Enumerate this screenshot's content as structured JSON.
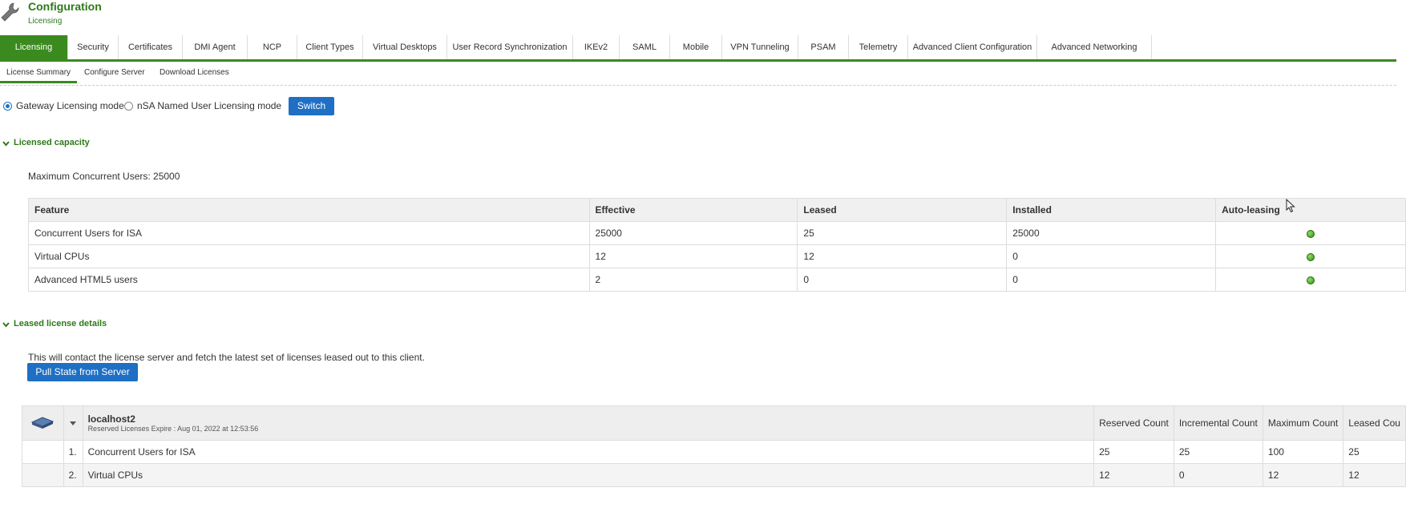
{
  "header": {
    "title": "Configuration",
    "subtitle": "Licensing"
  },
  "tabs": [
    {
      "label": "Licensing",
      "active": true
    },
    {
      "label": "Security"
    },
    {
      "label": "Certificates"
    },
    {
      "label": "DMI Agent"
    },
    {
      "label": "NCP"
    },
    {
      "label": "Client Types"
    },
    {
      "label": "Virtual Desktops"
    },
    {
      "label": "User Record Synchronization"
    },
    {
      "label": "IKEv2"
    },
    {
      "label": "SAML"
    },
    {
      "label": "Mobile"
    },
    {
      "label": "VPN Tunneling"
    },
    {
      "label": "PSAM"
    },
    {
      "label": "Telemetry"
    },
    {
      "label": "Advanced Client Configuration"
    },
    {
      "label": "Advanced Networking"
    }
  ],
  "subtabs": [
    {
      "label": "License Summary",
      "active": true
    },
    {
      "label": "Configure Server"
    },
    {
      "label": "Download Licenses"
    }
  ],
  "mode": {
    "gateway_label": "Gateway Licensing mode",
    "gateway_checked": true,
    "nsa_label": "nSA Named User Licensing mode",
    "nsa_checked": false,
    "switch_label": "Switch"
  },
  "licensed_capacity": {
    "heading": "Licensed capacity",
    "max_users_text": "Maximum Concurrent Users: 25000",
    "columns": [
      "Feature",
      "Effective",
      "Leased",
      "Installed",
      "Auto-leasing"
    ],
    "rows": [
      {
        "feature": "Concurrent Users for ISA",
        "effective": "25000",
        "leased": "25",
        "installed": "25000",
        "auto_leasing": "enabled"
      },
      {
        "feature": "Virtual CPUs",
        "effective": "12",
        "leased": "12",
        "installed": "0",
        "auto_leasing": "enabled"
      },
      {
        "feature": "Advanced HTML5 users",
        "effective": "2",
        "leased": "0",
        "installed": "0",
        "auto_leasing": "enabled"
      }
    ]
  },
  "leased_details": {
    "heading": "Leased license details",
    "description": "This will contact the license server and fetch the latest set of licenses leased out to this client.",
    "pull_button": "Pull State from Server",
    "server": {
      "name": "localhost2",
      "expire_text": "Reserved Licenses Expire : Aug 01, 2022 at 12:53:56",
      "icon": "server-icon"
    },
    "columns": [
      "Reserved Count",
      "Incremental Count",
      "Maximum Count",
      "Leased Cou"
    ],
    "rows": [
      {
        "index": "1.",
        "feature": "Concurrent Users for ISA",
        "reserved": "25",
        "incremental": "25",
        "maximum": "100",
        "leased": "25"
      },
      {
        "index": "2.",
        "feature": "Virtual CPUs",
        "reserved": "12",
        "incremental": "0",
        "maximum": "12",
        "leased": "12"
      }
    ]
  },
  "colors": {
    "accent_green": "#3b8a1f",
    "button_blue": "#1f6fc4",
    "status_green": "#2f8a12"
  }
}
